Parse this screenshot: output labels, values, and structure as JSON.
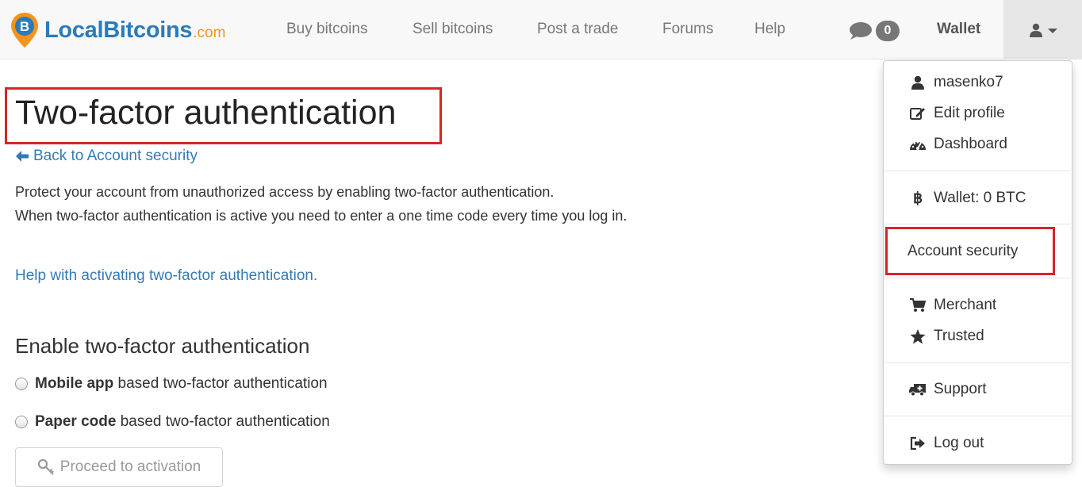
{
  "brand": {
    "name": "LocalBitcoins",
    "tld": ".com"
  },
  "nav": {
    "buy": "Buy bitcoins",
    "sell": "Sell bitcoins",
    "post": "Post a trade",
    "forums": "Forums",
    "help": "Help",
    "messages_count": "0",
    "wallet": "Wallet"
  },
  "page": {
    "title": "Two-factor authentication",
    "back_link": "Back to Account security",
    "desc_line1": "Protect your account from unauthorized access by enabling two-factor authentication.",
    "desc_line2": "When two-factor authentication is active you need to enter a one time code every time you log in.",
    "help_link": "Help with activating two-factor authentication.",
    "section_title": "Enable two-factor authentication",
    "option_mobile_bold": "Mobile app",
    "option_mobile_rest": " based two-factor authentication",
    "option_paper_bold": "Paper code",
    "option_paper_rest": " based two-factor authentication",
    "proceed_button": "Proceed to activation"
  },
  "user_menu": {
    "username": "masenko7",
    "edit_profile": "Edit profile",
    "dashboard": "Dashboard",
    "wallet": "Wallet: 0 BTC",
    "account_security": "Account security",
    "merchant": "Merchant",
    "trusted": "Trusted",
    "support": "Support",
    "logout": "Log out"
  },
  "colors": {
    "link": "#337ab7",
    "highlight": "#d9232a",
    "brand_blue": "#2b7bb9",
    "brand_orange": "#f7931a"
  }
}
